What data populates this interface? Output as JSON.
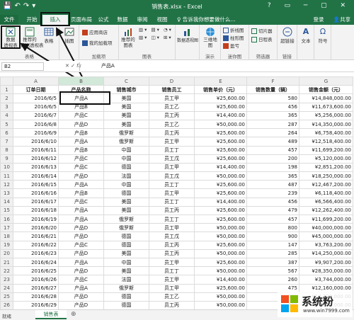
{
  "window": {
    "title": "销售表.xlsx - Excel",
    "login": "登录",
    "share": "共享"
  },
  "tabs": [
    "文件",
    "开始",
    "插入",
    "页面布局",
    "公式",
    "数据",
    "审阅",
    "视图"
  ],
  "search": "告诉我你想要做什么...",
  "ribbon": {
    "pivot": "数据\n透视表",
    "recommend_pivot": "推荐的\n数据透视表",
    "table": "表格",
    "group_tables": "表格",
    "illustrations": "插图",
    "store": "应用商店",
    "my_addins": "我的加载项",
    "group_addins": "加载项",
    "recommend_charts": "推荐的\n图表",
    "group_charts": "图表",
    "pivot_chart": "数据透视图",
    "map3d": "三维地\n图",
    "group_tours": "演示",
    "line": "折线图",
    "column": "柱形图",
    "winloss": "盈亏",
    "group_spark": "迷你图",
    "slicer": "切片器",
    "timeline": "日程表",
    "group_filter": "筛选器",
    "hyperlink": "超链接",
    "group_links": "链接",
    "text": "文本",
    "symbol": "符号"
  },
  "formula": {
    "namebox": "B2",
    "value": "产品A"
  },
  "columns": [
    "A",
    "B",
    "C",
    "D",
    "E",
    "F",
    "G"
  ],
  "header": [
    "订单日期",
    "产品名称",
    "销售城市",
    "销售员工",
    "销售单价（元）",
    "销售数量（辆）",
    "销售金额（元）"
  ],
  "rows": [
    [
      "2016/6/5",
      "产品A",
      "美国",
      "员工甲",
      "¥25,600.00",
      "580",
      "¥14,848,000.00"
    ],
    [
      "2016/6/5",
      "产品B",
      "美国",
      "员工乙",
      "¥25,600.00",
      "456",
      "¥11,673,600.00"
    ],
    [
      "2016/6/7",
      "产品C",
      "美国",
      "员工丙",
      "¥14,400.00",
      "365",
      "¥5,256,000.00"
    ],
    [
      "2016/6/8",
      "产品D",
      "美国",
      "员工乙",
      "¥50,000.00",
      "287",
      "¥14,350,000.00"
    ],
    [
      "2016/6/9",
      "产品B",
      "俄罗斯",
      "员工丙",
      "¥25,600.00",
      "264",
      "¥6,758,400.00"
    ],
    [
      "2016/6/10",
      "产品A",
      "俄罗斯",
      "员工甲",
      "¥25,600.00",
      "489",
      "¥12,518,400.00"
    ],
    [
      "2016/6/11",
      "产品B",
      "中国",
      "员工丁",
      "¥25,600.00",
      "457",
      "¥11,699,200.00"
    ],
    [
      "2016/6/12",
      "产品C",
      "中国",
      "员工戊",
      "¥25,600.00",
      "200",
      "¥5,120,000.00"
    ],
    [
      "2016/6/13",
      "产品C",
      "德国",
      "员工甲",
      "¥14,400.00",
      "198",
      "¥2,851,200.00"
    ],
    [
      "2016/6/14",
      "产品D",
      "法国",
      "员工戊",
      "¥50,000.00",
      "365",
      "¥18,250,000.00"
    ],
    [
      "2016/6/15",
      "产品A",
      "中国",
      "员工丁",
      "¥25,600.00",
      "487",
      "¥12,467,200.00"
    ],
    [
      "2016/6/16",
      "产品B",
      "德国",
      "员工甲",
      "¥25,600.00",
      "239",
      "¥6,118,400.00"
    ],
    [
      "2016/6/17",
      "产品C",
      "美国",
      "员工丁",
      "¥14,400.00",
      "456",
      "¥6,566,400.00"
    ],
    [
      "2016/6/18",
      "产品A",
      "美国",
      "员工丙",
      "¥25,600.00",
      "479",
      "¥12,262,400.00"
    ],
    [
      "2016/6/19",
      "产品A",
      "俄罗斯",
      "员工丁",
      "¥25,600.00",
      "457",
      "¥11,699,200.00"
    ],
    [
      "2016/6/20",
      "产品D",
      "俄罗斯",
      "员工甲",
      "¥50,000.00",
      "800",
      "¥40,000,000.00"
    ],
    [
      "2016/6/21",
      "产品D",
      "德国",
      "员工戊",
      "¥50,000.00",
      "900",
      "¥45,000,000.00"
    ],
    [
      "2016/6/22",
      "产品C",
      "德国",
      "员工丙",
      "¥25,600.00",
      "147",
      "¥3,763,200.00"
    ],
    [
      "2016/6/23",
      "产品D",
      "美国",
      "员工丙",
      "¥50,000.00",
      "285",
      "¥14,250,000.00"
    ],
    [
      "2016/6/24",
      "产品A",
      "中国",
      "员工甲",
      "¥25,600.00",
      "387",
      "¥9,907,200.00"
    ],
    [
      "2016/6/25",
      "产品D",
      "美国",
      "员工丁",
      "¥50,000.00",
      "567",
      "¥28,350,000.00"
    ],
    [
      "2016/6/26",
      "产品C",
      "法国",
      "员工甲",
      "¥14,400.00",
      "260",
      "¥3,744,000.00"
    ],
    [
      "2016/6/27",
      "产品A",
      "俄罗斯",
      "员工甲",
      "¥25,600.00",
      "475",
      "¥12,160,000.00"
    ],
    [
      "2016/6/28",
      "产品D",
      "德国",
      "员工乙",
      "¥50,000.00",
      "286",
      "¥14,300,000.00"
    ],
    [
      "2016/6/29",
      "产品D",
      "德国",
      "员工丙",
      "¥50,000.00",
      "280",
      "¥14,000,000.00"
    ]
  ],
  "status": {
    "ready": "就绪",
    "sheet": "销售表",
    "add": "⊕"
  },
  "watermark": {
    "text": "系统粉",
    "url": "www.win7999.com"
  },
  "colors": {
    "excel_green": "#217346"
  }
}
